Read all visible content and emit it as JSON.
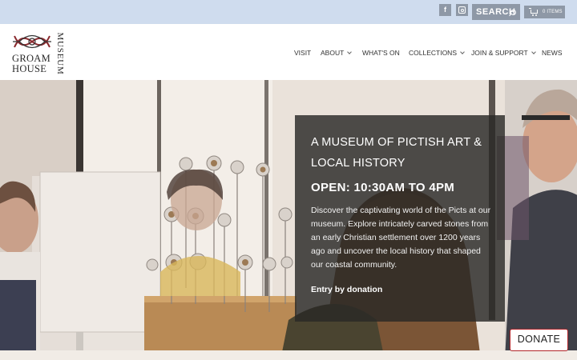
{
  "topbar": {
    "social": [
      {
        "name": "facebook",
        "label": "f"
      },
      {
        "name": "instagram",
        "label": ""
      }
    ],
    "search_label": "SEARCH",
    "cart_label": "0 ITEMS"
  },
  "logo": {
    "line1": "GROAM",
    "line2": "HOUSE",
    "vertical": "MUSEUM"
  },
  "nav": {
    "items": [
      {
        "label": "VISIT",
        "has_dropdown": false
      },
      {
        "label": "ABOUT",
        "has_dropdown": true
      },
      {
        "label": "WHAT'S ON",
        "has_dropdown": false
      },
      {
        "label": "COLLECTIONS",
        "has_dropdown": true
      },
      {
        "label": "JOIN & SUPPORT",
        "has_dropdown": true
      },
      {
        "label": "NEWS",
        "has_dropdown": false
      }
    ]
  },
  "hero": {
    "title": "A MUSEUM OF PICTISH ART & LOCAL HISTORY",
    "hours": "OPEN: 10:30AM TO 4PM",
    "description": "Discover the captivating world of the Picts at our museum. Explore intricately carved stones from an early Christian settlement over 1200 years ago and uncover the local history that shaped our coastal community.",
    "entry": "Entry by donation"
  },
  "donate_label": "DONATE",
  "colors": {
    "topbar_bg": "#cfdcee",
    "button_grey": "#8e98a6",
    "overlay": "#2a2826",
    "donate_border": "#b2262a"
  }
}
